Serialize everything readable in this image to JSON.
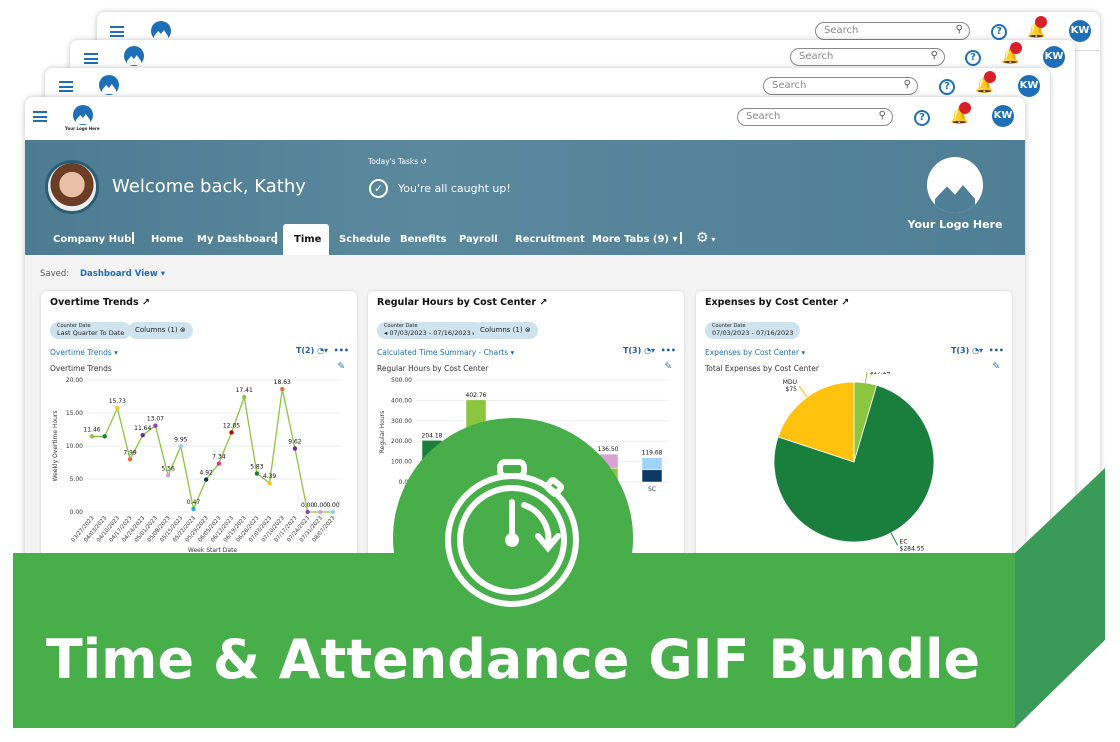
{
  "topbar": {
    "search_placeholder": "Search",
    "help_icon": "?",
    "avatar_initials": "KW",
    "logo_caption": "Your Logo Here"
  },
  "hero": {
    "welcome": "Welcome back, Kathy",
    "tasks_label": "Today's Tasks",
    "tasks_status": "You're all caught up!",
    "brand_logo_text": "Your Logo Here"
  },
  "tabs": [
    {
      "label": "Company Hub"
    },
    {
      "label": "Home"
    },
    {
      "label": "My Dashboard"
    },
    {
      "label": "Time",
      "active": true
    },
    {
      "label": "Schedule"
    },
    {
      "label": "Benefits"
    },
    {
      "label": "Payroll"
    },
    {
      "label": "Recruitment"
    },
    {
      "label": "More Tabs (9) ▾"
    }
  ],
  "saved": {
    "label": "Saved:",
    "view": "Dashboard View ▾"
  },
  "cards": [
    {
      "title": "Overtime Trends ↗",
      "chip_label": "Counter Date",
      "chip_value": "Last Quarter To Date",
      "columns": "Columns (1) ⊗",
      "dropdown": "Overtime Trends ▾",
      "filters": "T(2)",
      "subtitle": "Overtime Trends"
    },
    {
      "title": "Regular Hours by Cost Center ↗",
      "chip_label": "Counter Date",
      "chip_value": "◂ 07/03/2023 - 07/16/2023 ▸",
      "columns": "Columns (1) ⊗",
      "dropdown": "Calculated Time Summary - Charts ▾",
      "filters": "T(3)",
      "subtitle": "Regular Hours by Cost Center"
    },
    {
      "title": "Expenses by Cost Center ↗",
      "chip_label": "Counter Date",
      "chip_value": "07/03/2023 - 07/16/2023",
      "dropdown": "Expenses by Cost Center ▾",
      "filters": "T(3)",
      "subtitle": "Total Expenses by Cost Center"
    }
  ],
  "chart_data": [
    {
      "type": "line",
      "ylabel": "Weekly Overtime Hours",
      "xlabel": "Week Start Date",
      "ylim": [
        0,
        20
      ],
      "yticks": [
        "0.00",
        "5.00",
        "10.00",
        "15.00",
        "20.00"
      ],
      "grid": true,
      "line_color": "#8cc63f",
      "x": [
        "03/27/2023",
        "04/03/2023",
        "04/10/2023",
        "04/17/2023",
        "04/24/2023",
        "05/01/2023",
        "05/08/2023",
        "05/15/2023",
        "05/22/2023",
        "05/29/2023",
        "06/05/2023",
        "06/12/2023",
        "06/19/2023",
        "06/26/2023",
        "07/03/2023",
        "07/10/2023",
        "07/17/2023",
        "07/24/2023",
        "07/31/2023",
        "08/07/2023"
      ],
      "y": [
        11.46,
        11.46,
        15.73,
        7.99,
        11.64,
        13.07,
        5.56,
        9.95,
        0.47,
        4.92,
        7.34,
        12.05,
        17.41,
        5.83,
        4.39,
        18.63,
        9.62,
        0,
        0,
        0
      ],
      "labels": [
        "11.46",
        null,
        "15.73",
        "7.99",
        "11.64",
        "13.07",
        "5.56",
        "9.95",
        "0.47",
        "4.92",
        "7.34",
        "12.05",
        "17.41",
        "5.83",
        "4.39",
        "18.63",
        "9.62",
        "0.00",
        "0.00",
        "0.00"
      ],
      "point_colors": [
        "#8cc63f",
        "#1a7f3c",
        "#ffc20e",
        "#f26b3a",
        "#6a2c91",
        "#9b3fb5",
        "#d9a0d0",
        "#8fd0f5",
        "#2aa8e0",
        "#0c2d5a",
        "#e8336d",
        "#c00000",
        "#8cc63f",
        "#1a7f3c",
        "#ffc20e",
        "#f26b3a",
        "#6a2c91",
        "#9b3fb5",
        "#d9a0d0",
        "#8fd0f5"
      ]
    },
    {
      "type": "bar",
      "stacked": true,
      "ylabel": "Regular Hours",
      "ylim": [
        0,
        500
      ],
      "yticks": [
        "0.00",
        "100.00",
        "200.00",
        "300.00",
        "400.00",
        "500.00"
      ],
      "grid": true,
      "categories": [
        "",
        "",
        "",
        "",
        "",
        "SC"
      ],
      "totals": [
        204.18,
        402.76,
        null,
        null,
        136.5,
        119.68
      ],
      "labels": [
        "204.18",
        "402.76",
        null,
        null,
        "136.50",
        "119.68"
      ],
      "segment_colors": [
        [
          "#f06060",
          "#1a7f3c"
        ],
        [
          "#ffc20e",
          "#8cc63f"
        ],
        [],
        [],
        [
          "#8cc63f",
          "#d9a0d0"
        ],
        [
          "#0c3a66",
          "#9fd3f7"
        ]
      ]
    },
    {
      "type": "pie",
      "slices": [
        {
          "label": "DV",
          "value": 17.24,
          "text": "$17.24",
          "color": "#8cc63f"
        },
        {
          "label": "EC",
          "value": 284.55,
          "text": "$284.55",
          "color": "#1a7f3c"
        },
        {
          "label": "MDU",
          "value": 75,
          "text": "$75",
          "color": "#ffc20e"
        }
      ]
    }
  ],
  "banner": {
    "title": "Time & Attendance GIF Bundle",
    "icon": "stopwatch-icon",
    "front_color": "#47ae4a",
    "side_color": "#3a9a57"
  }
}
